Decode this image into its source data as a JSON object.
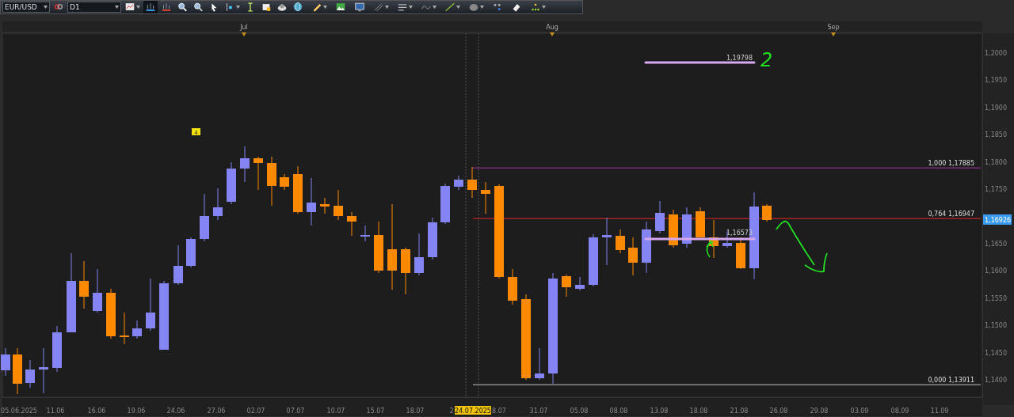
{
  "toolbar": {
    "symbol": "EUR/USD",
    "timeframe": "D1",
    "tools": [
      {
        "kind": "link",
        "selected": false,
        "menu": false
      },
      {
        "kind": "chart",
        "selected": false,
        "menu": true
      },
      {
        "kind": "line-blue",
        "selected": true,
        "menu": false
      },
      {
        "kind": "line-red",
        "selected": false,
        "menu": false
      },
      {
        "kind": "zoom-in",
        "selected": false,
        "menu": false
      },
      {
        "kind": "zoom-out",
        "selected": false,
        "menu": false
      },
      {
        "kind": "cursor",
        "selected": false,
        "menu": false
      },
      {
        "kind": "point",
        "selected": false,
        "menu": true
      },
      {
        "kind": "text",
        "selected": false,
        "menu": false
      },
      {
        "kind": "note",
        "selected": false,
        "menu": false
      },
      {
        "kind": "cloud",
        "selected": false,
        "menu": false
      },
      {
        "kind": "globe",
        "selected": false,
        "menu": false
      },
      {
        "kind": "pencil",
        "selected": false,
        "menu": true
      },
      {
        "kind": "image",
        "selected": false,
        "menu": false
      },
      {
        "kind": "screen",
        "selected": false,
        "menu": false
      },
      {
        "kind": "diagonal",
        "selected": false,
        "menu": true
      },
      {
        "kind": "bars",
        "selected": false,
        "menu": true
      },
      {
        "kind": "wave",
        "selected": false,
        "menu": true
      },
      {
        "kind": "line",
        "selected": false,
        "menu": true
      },
      {
        "kind": "circle",
        "selected": false,
        "menu": true
      },
      {
        "kind": "dots",
        "selected": false,
        "menu": false
      },
      {
        "kind": "eraser",
        "selected": false,
        "menu": false
      },
      {
        "kind": "grid",
        "selected": false,
        "menu": true
      }
    ]
  },
  "chart": {
    "months": [
      "Jul",
      "Aug",
      "Sep"
    ],
    "price_axis": [
      "1,2000",
      "1,1950",
      "1,1900",
      "1,1850",
      "1,1800",
      "1,1750",
      "1,1650",
      "1,1600",
      "1,1550",
      "1,1500",
      "1,1450",
      "1,1400"
    ],
    "current_price": "1,16926",
    "date_axis": [
      {
        "text": "05.06.2025",
        "selected": false
      },
      {
        "text": "11.06",
        "selected": false
      },
      {
        "text": "16.06",
        "selected": false
      },
      {
        "text": "19.06",
        "selected": false
      },
      {
        "text": "24.06",
        "selected": false
      },
      {
        "text": "27.06",
        "selected": false
      },
      {
        "text": "02.07",
        "selected": false
      },
      {
        "text": "07.07",
        "selected": false
      },
      {
        "text": "10.07",
        "selected": false
      },
      {
        "text": "15.07",
        "selected": false
      },
      {
        "text": "18.07",
        "selected": false
      },
      {
        "text": "2",
        "selected": false
      },
      {
        "text": "24.07.2025",
        "selected": true
      },
      {
        "text": "8.07",
        "selected": false
      },
      {
        "text": "31.07",
        "selected": false
      },
      {
        "text": "05.08",
        "selected": false
      },
      {
        "text": "08.08",
        "selected": false
      },
      {
        "text": "13.08",
        "selected": false
      },
      {
        "text": "18.08",
        "selected": false
      },
      {
        "text": "21.08",
        "selected": false
      },
      {
        "text": "26.08",
        "selected": false
      },
      {
        "text": "29.08",
        "selected": false
      },
      {
        "text": "03.09",
        "selected": false
      },
      {
        "text": "08.09",
        "selected": false
      },
      {
        "text": "11.09",
        "selected": false
      }
    ],
    "fib_levels": [
      {
        "label": "1,000 1,17885",
        "color": "#7a2a7a"
      },
      {
        "label": "0,764 1,16947",
        "color": "#a02020"
      },
      {
        "label": "0,000 1,13911",
        "color": "#8a8a8a"
      }
    ],
    "lines": [
      {
        "label": "1,19798"
      },
      {
        "label": "1,16573"
      }
    ],
    "event_badge": "4",
    "handwritten_note": "2"
  }
}
